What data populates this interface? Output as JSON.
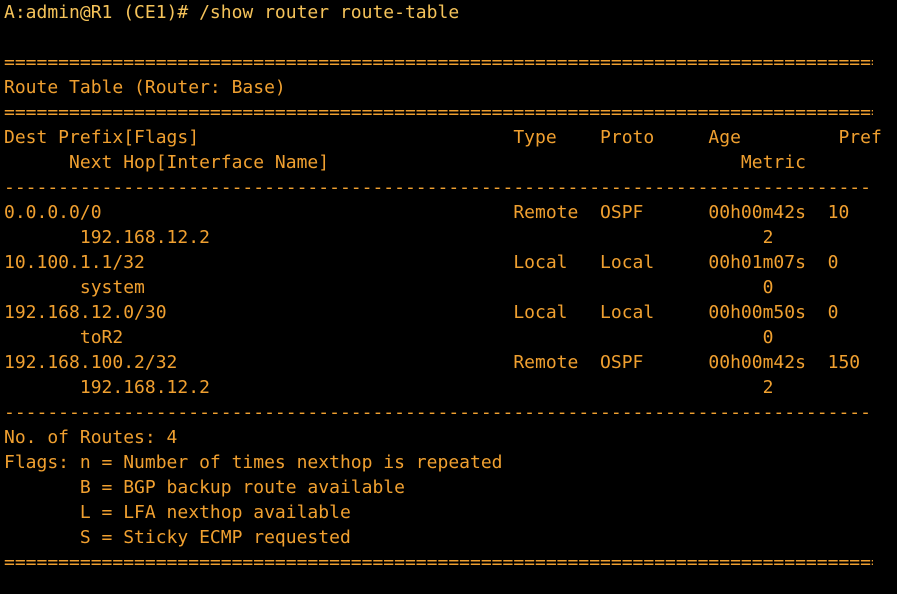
{
  "terminal": {
    "prompt": "A:admin@R1 (CE1)# /show router route-table",
    "separator_double": "=========================================================================================",
    "separator_single": "-----------------------------------------------------------------------------------------",
    "table_title": "Route Table (Router: Base)",
    "header_line1": "Dest Prefix[Flags]                             Type    Proto     Age         Pref",
    "header_line2": "      Next Hop[Interface Name]                                      Metric",
    "rows": [
      {
        "line1": "0.0.0.0/0                                      Remote  OSPF      00h00m42s  10",
        "line2": "       192.168.12.2                                                   2"
      },
      {
        "line1": "10.100.1.1/32                                  Local   Local     00h01m07s  0",
        "line2": "       system                                                         0"
      },
      {
        "line1": "192.168.12.0/30                                Local   Local     00h00m50s  0",
        "line2": "       toR2                                                           0"
      },
      {
        "line1": "192.168.100.2/32                               Remote  OSPF      00h00m42s  150",
        "line2": "       192.168.12.2                                                   2"
      }
    ],
    "route_count": "No. of Routes: 4",
    "flags": [
      "Flags: n = Number of times nexthop is repeated",
      "       B = BGP backup route available",
      "       L = LFA nexthop available",
      "       S = Sticky ECMP requested"
    ]
  }
}
